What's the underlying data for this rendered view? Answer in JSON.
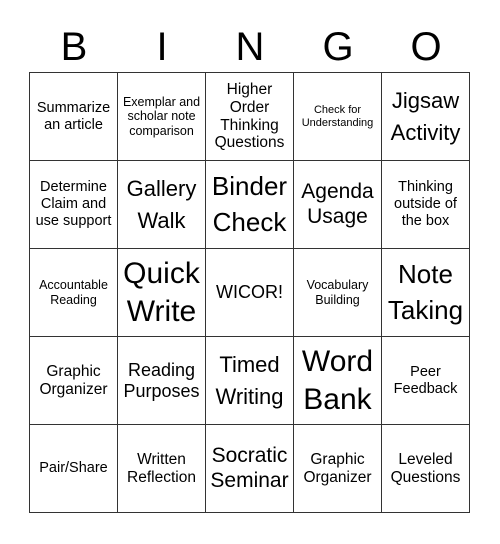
{
  "header": {
    "letters": [
      "B",
      "I",
      "N",
      "G",
      "O"
    ]
  },
  "cells": [
    [
      "Summarize an article",
      "Exemplar and scholar note comparison",
      "Higher Order Thinking Questions",
      "Check for Understanding",
      "Jigsaw Activity"
    ],
    [
      "Determine Claim and use support",
      "Gallery Walk",
      "Binder Check",
      "Agenda Usage",
      "Thinking outside of the box"
    ],
    [
      "Accountable Reading",
      "Quick Write",
      "WICOR!",
      "Vocabulary Building",
      "Note Taking"
    ],
    [
      "Graphic Organizer",
      "Reading Purposes",
      "Timed Writing",
      "Word Bank",
      "Peer Feedback"
    ],
    [
      "Pair/Share",
      "Written Reflection",
      "Socratic Seminar",
      "Graphic Organizer",
      "Leveled Questions"
    ]
  ]
}
